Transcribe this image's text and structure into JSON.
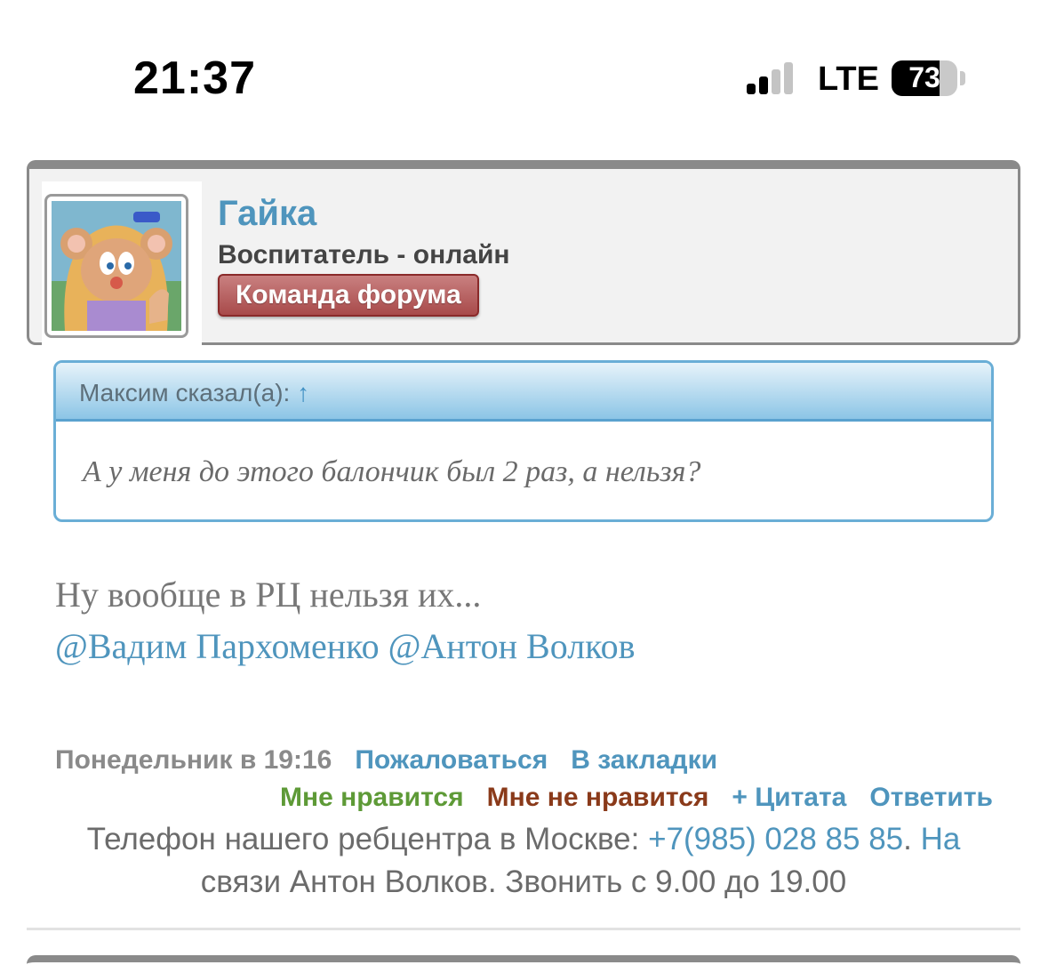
{
  "status_bar": {
    "time": "21:37",
    "network": "LTE",
    "battery": "73",
    "battery_level": 0.73
  },
  "post": {
    "author": {
      "name": "Гайка",
      "title": "Воспитатель - онлайн",
      "badge": "Команда форума"
    },
    "quote": {
      "author": "Максим сказал(а):",
      "arrow": "↑",
      "text": "А у меня до этого балончик был 2 раз, а нельзя?"
    },
    "message": {
      "line1": "Ну вообще в РЦ нельзя их...",
      "mentions": "@Вадим Пархоменко @Антон Волков"
    },
    "meta": {
      "date": "Понедельник в 19:16",
      "report": "Пожаловаться",
      "bookmark": "В закладки",
      "like": "Мне нравится",
      "dislike": "Мне не нравится",
      "quote": "+ Цитата",
      "reply": "Ответить"
    },
    "signature": {
      "before": "Телефон нашего ребцентра в Москве: ",
      "phone": "+7(985) 028 85 85",
      "after_dot": ".",
      "na": " На",
      "line2": "связи Антон Волков. Звонить с 9.00 до 19.00"
    }
  },
  "colors": {
    "link": "#4f95bd",
    "like": "#5e9a37",
    "dislike": "#8a3a1a",
    "badge": "#a84a4a"
  }
}
